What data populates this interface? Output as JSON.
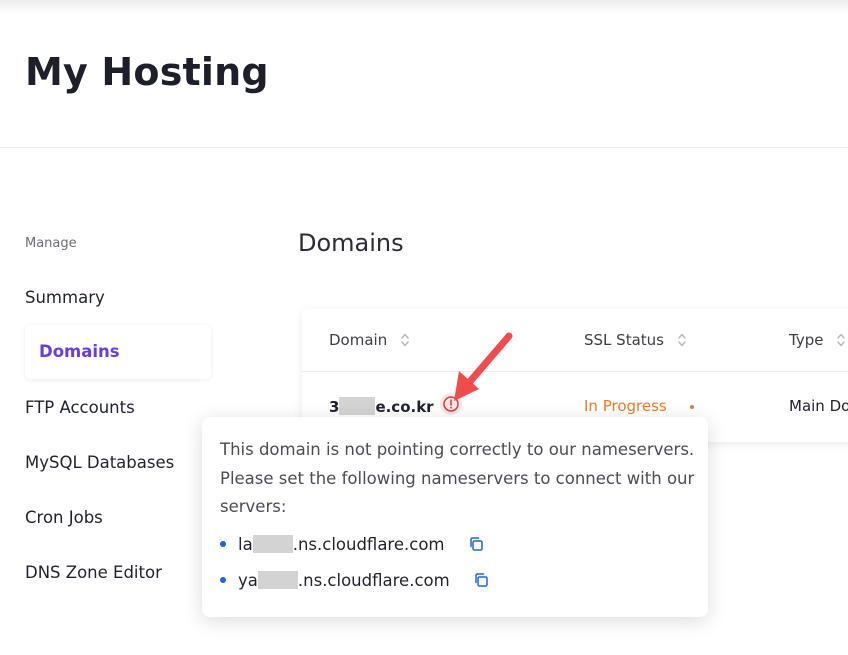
{
  "header": {
    "title": "My Hosting"
  },
  "sidebar": {
    "section_label": "Manage",
    "items": [
      {
        "label": "Summary",
        "active": false
      },
      {
        "label": "Domains",
        "active": true
      },
      {
        "label": "FTP Accounts",
        "active": false
      },
      {
        "label": "MySQL Databases",
        "active": false
      },
      {
        "label": "Cron Jobs",
        "active": false
      },
      {
        "label": "DNS Zone Editor",
        "active": false
      }
    ]
  },
  "main": {
    "section_title": "Domains",
    "table": {
      "columns": [
        "Domain",
        "SSL Status",
        "Type"
      ],
      "rows": [
        {
          "domain_prefix": "3",
          "domain_suffix": "e.co.kr",
          "ssl_status": "In Progress",
          "type": "Main Do"
        }
      ]
    }
  },
  "popover": {
    "message": "This domain is not pointing correctly to our nameservers. Please set the following nameservers to connect with our servers:",
    "nameservers": [
      {
        "prefix": "la",
        "suffix": ".ns.cloudflare.com"
      },
      {
        "prefix": "ya",
        "suffix": ".ns.cloudflare.com"
      }
    ]
  },
  "colors": {
    "accent": "#673de6",
    "warning": "#f07a2a",
    "alert": "#e03a3a",
    "link_blue": "#1a66d9"
  },
  "icons": {
    "sort": "sort-icon",
    "alert": "alert-circle-icon",
    "copy": "copy-icon",
    "pointer": "red-arrow-annotation"
  }
}
